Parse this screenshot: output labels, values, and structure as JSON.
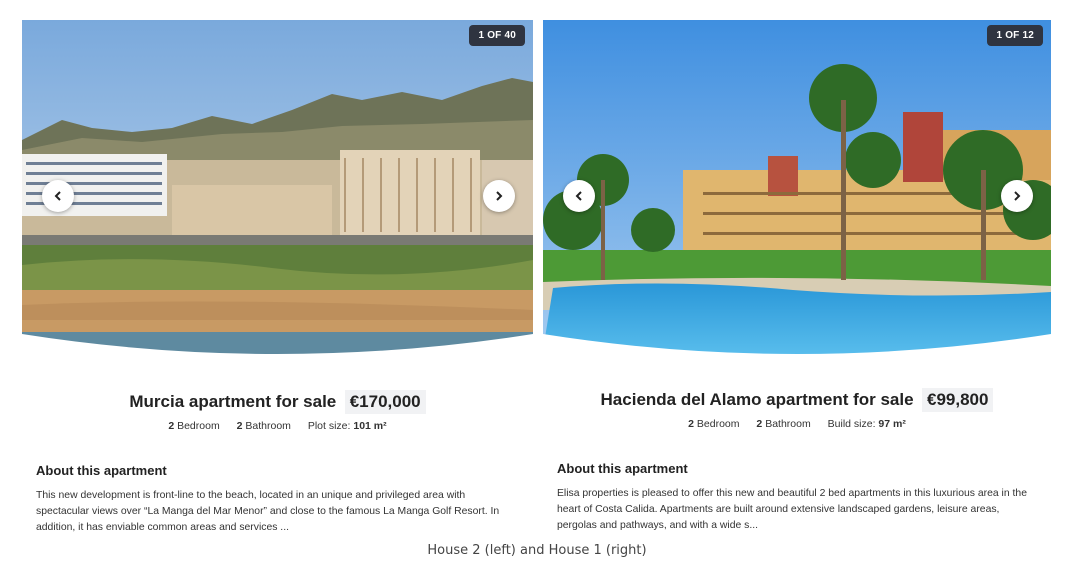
{
  "listings": [
    {
      "counter": "1 OF 40",
      "title": "Murcia apartment for sale",
      "price": "€170,000",
      "bedrooms": "2",
      "bedroom_label": "Bedroom",
      "bathrooms": "2",
      "bathroom_label": "Bathroom",
      "size_label": "Plot size:",
      "size_value": "101 m²",
      "about_heading": "About this apartment",
      "about_text": "This new development is front-line to the beach, located in an unique and privileged area with spectacular views over “La Manga del Mar Menor” and close to the famous La Manga Golf Resort. In addition, it has enviable common areas and services ..."
    },
    {
      "counter": "1 OF 12",
      "title": "Hacienda del Alamo apartment for sale",
      "price": "€99,800",
      "bedrooms": "2",
      "bedroom_label": "Bedroom",
      "bathrooms": "2",
      "bathroom_label": "Bathroom",
      "size_label": "Build size:",
      "size_value": "97 m²",
      "about_heading": "About this apartment",
      "about_text": "Elisa properties is pleased to offer this new and beautiful 2 bed apartments in this luxurious area in the heart of Costa Calida. Apartments are built around extensive landscaped gardens, leisure areas, pergolas and pathways, and with a wide s..."
    }
  ],
  "caption": "House 2 (left) and House 1 (right)",
  "icons": {
    "prev": "chevron-left-icon",
    "next": "chevron-right-icon"
  }
}
